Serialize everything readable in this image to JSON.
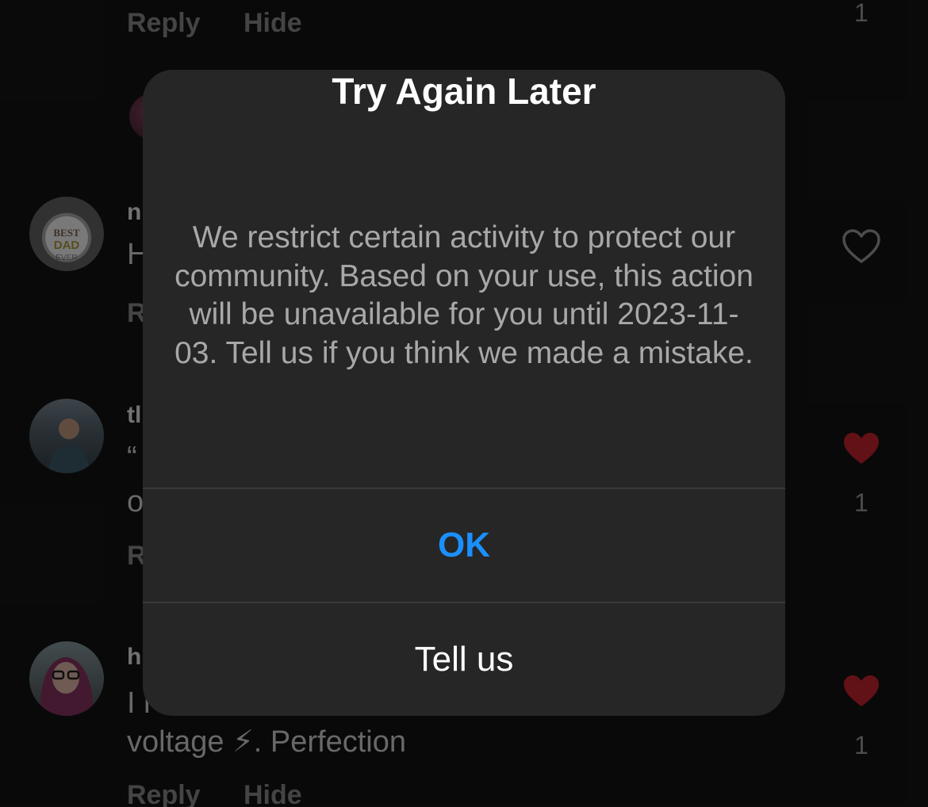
{
  "comments": {
    "top_actions": {
      "reply": "Reply",
      "hide": "Hide",
      "count": "1"
    },
    "c1": {
      "username_initial": "n",
      "body_initial": "H",
      "reply_initial": "R"
    },
    "c2": {
      "username_initial": "tl",
      "body_initial": "“",
      "body_line2_initial": "o",
      "reply_initial": "R",
      "count": "1"
    },
    "c3": {
      "username_initial": "h",
      "body_line1": "I l",
      "body_line2": "voltage ⚡. Perfection",
      "count": "1"
    },
    "bottom_actions": {
      "reply": "Reply",
      "hide": "Hide"
    }
  },
  "alert": {
    "title": "Try Again Later",
    "message": "We restrict certain activity to protect our community. Based on your use, this action will be unavailable for you until 2023-11-03. Tell us if you think we made a mistake.",
    "ok_label": "OK",
    "tell_label": "Tell us"
  },
  "colors": {
    "background": "#121212",
    "dialog": "#262626",
    "accent": "#1a90ff",
    "liked": "#b3202a"
  },
  "icons": {
    "heart_outline": "heart-outline-icon",
    "heart_filled": "heart-filled-icon"
  }
}
